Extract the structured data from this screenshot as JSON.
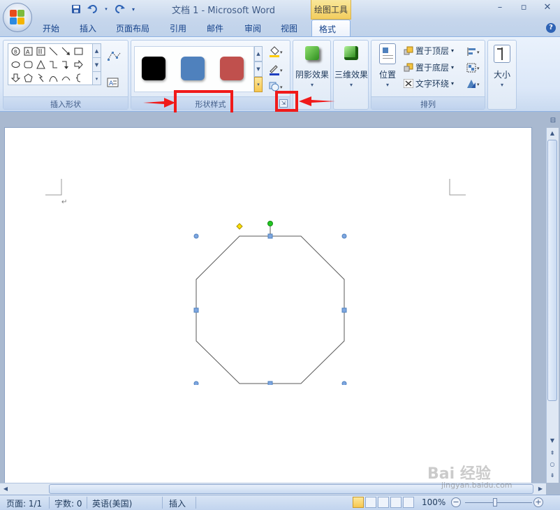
{
  "window": {
    "title": "文档 1 - Microsoft Word",
    "context_tab_group": "绘图工具",
    "minimize": "–",
    "maximize": "▫",
    "close": "✕"
  },
  "tabs": [
    {
      "label": "开始"
    },
    {
      "label": "插入"
    },
    {
      "label": "页面布局"
    },
    {
      "label": "引用"
    },
    {
      "label": "邮件"
    },
    {
      "label": "审阅"
    },
    {
      "label": "视图"
    },
    {
      "label": "格式",
      "active": true
    }
  ],
  "ribbon": {
    "insert_shapes": {
      "label": "插入形状"
    },
    "shape_styles": {
      "label": "形状样式",
      "swatches": [
        "#000000",
        "#4f81bd",
        "#c0504d"
      ]
    },
    "shadow_effects": {
      "label": "阴影效果"
    },
    "effects_3d": {
      "label": "三维效果"
    },
    "arrange": {
      "label": "排列",
      "position": "位置",
      "bring_to_front": "置于顶层",
      "send_to_back": "置于底层",
      "text_wrap": "文字环绕"
    },
    "size": {
      "label": "大小"
    }
  },
  "status": {
    "page": "页面: 1/1",
    "words": "字数: 0",
    "language": "英语(美国)",
    "mode": "插入",
    "zoom": "100%"
  },
  "watermark": {
    "brand": "Bai 经验",
    "url": "jingyan.baidu.com"
  },
  "colors": {
    "highlight_red": "#f01a1a",
    "shape_stroke": "#595959",
    "handle_blue": "#4f81bd",
    "rotate_handle": "#22c722",
    "adjust_handle": "#ffe000"
  }
}
